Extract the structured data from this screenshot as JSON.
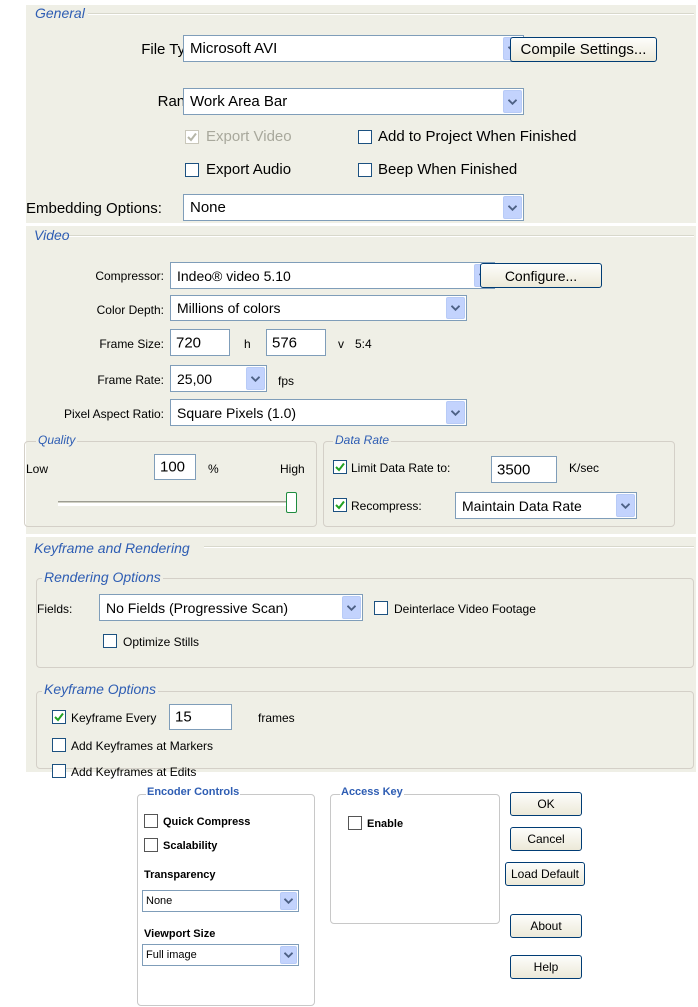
{
  "general": {
    "legend": "General",
    "file_type_label": "File Type:",
    "file_type_value": "Microsoft AVI",
    "compile_settings_button": "Compile Settings...",
    "range_label": "Range:",
    "range_value": "Work Area Bar",
    "export_video_label": "Export Video",
    "export_video_checked": true,
    "export_video_disabled": true,
    "export_audio_label": "Export Audio",
    "export_audio_checked": false,
    "add_to_project_label": "Add to Project When Finished",
    "add_to_project_checked": false,
    "beep_label": "Beep When Finished",
    "beep_checked": false,
    "embedding_label": "Embedding Options:",
    "embedding_value": "None"
  },
  "video": {
    "legend": "Video",
    "compressor_label": "Compressor:",
    "compressor_value": "Indeo® video 5.10",
    "configure_button": "Configure...",
    "color_depth_label": "Color Depth:",
    "color_depth_value": "Millions of colors",
    "frame_size_label": "Frame Size:",
    "frame_width": "720",
    "h_label": "h",
    "frame_height": "576",
    "v_label": "v",
    "aspect_label": "5:4",
    "frame_rate_label": "Frame Rate:",
    "frame_rate_value": "25,00",
    "fps_label": "fps",
    "pixel_aspect_label": "Pixel Aspect Ratio:",
    "pixel_aspect_value": "Square Pixels (1.0)",
    "quality": {
      "legend": "Quality",
      "low_label": "Low",
      "value": "100",
      "percent_label": "%",
      "high_label": "High",
      "slider_level": 1.0
    },
    "data_rate": {
      "legend": "Data Rate",
      "limit_label": "Limit Data Rate to:",
      "limit_checked": true,
      "limit_value": "3500",
      "unit_label": "K/sec",
      "recompress_label": "Recompress:",
      "recompress_checked": true,
      "recompress_value": "Maintain Data Rate"
    }
  },
  "keyframe": {
    "legend": "Keyframe and Rendering",
    "rendering": {
      "legend": "Rendering Options",
      "fields_label": "Fields:",
      "fields_value": "No Fields (Progressive Scan)",
      "deinterlace_label": "Deinterlace Video Footage",
      "deinterlace_checked": false,
      "optimize_label": "Optimize Stills",
      "optimize_checked": false
    },
    "options": {
      "legend": "Keyframe Options",
      "every_label": "Keyframe Every",
      "every_checked": true,
      "every_value": "15",
      "frames_label": "frames",
      "markers_label": "Add Keyframes at Markers",
      "markers_checked": false,
      "edits_label": "Add Keyframes at Edits",
      "edits_checked": false
    }
  },
  "encoder": {
    "legend": "Encoder Controls",
    "quick_compress_label": "Quick Compress",
    "quick_compress_checked": false,
    "scalability_label": "Scalability",
    "scalability_checked": false,
    "transparency_label": "Transparency",
    "transparency_value": "None",
    "viewport_label": "Viewport Size",
    "viewport_value": "Full image"
  },
  "access_key": {
    "legend": "Access Key",
    "enable_label": "Enable",
    "enable_checked": false
  },
  "buttons": {
    "ok": "OK",
    "cancel": "Cancel",
    "load_default": "Load Default",
    "about": "About",
    "help": "Help"
  },
  "colors": {
    "panel_bg": "#efefe6",
    "legend_text": "#2e5db3",
    "check_mark": "#21a121",
    "input_border": "#7f9db9",
    "dropdown_arrow_bg": "#c3d3fd"
  },
  "icons": {
    "dropdown": "chevron-down-icon",
    "check": "check-icon"
  }
}
